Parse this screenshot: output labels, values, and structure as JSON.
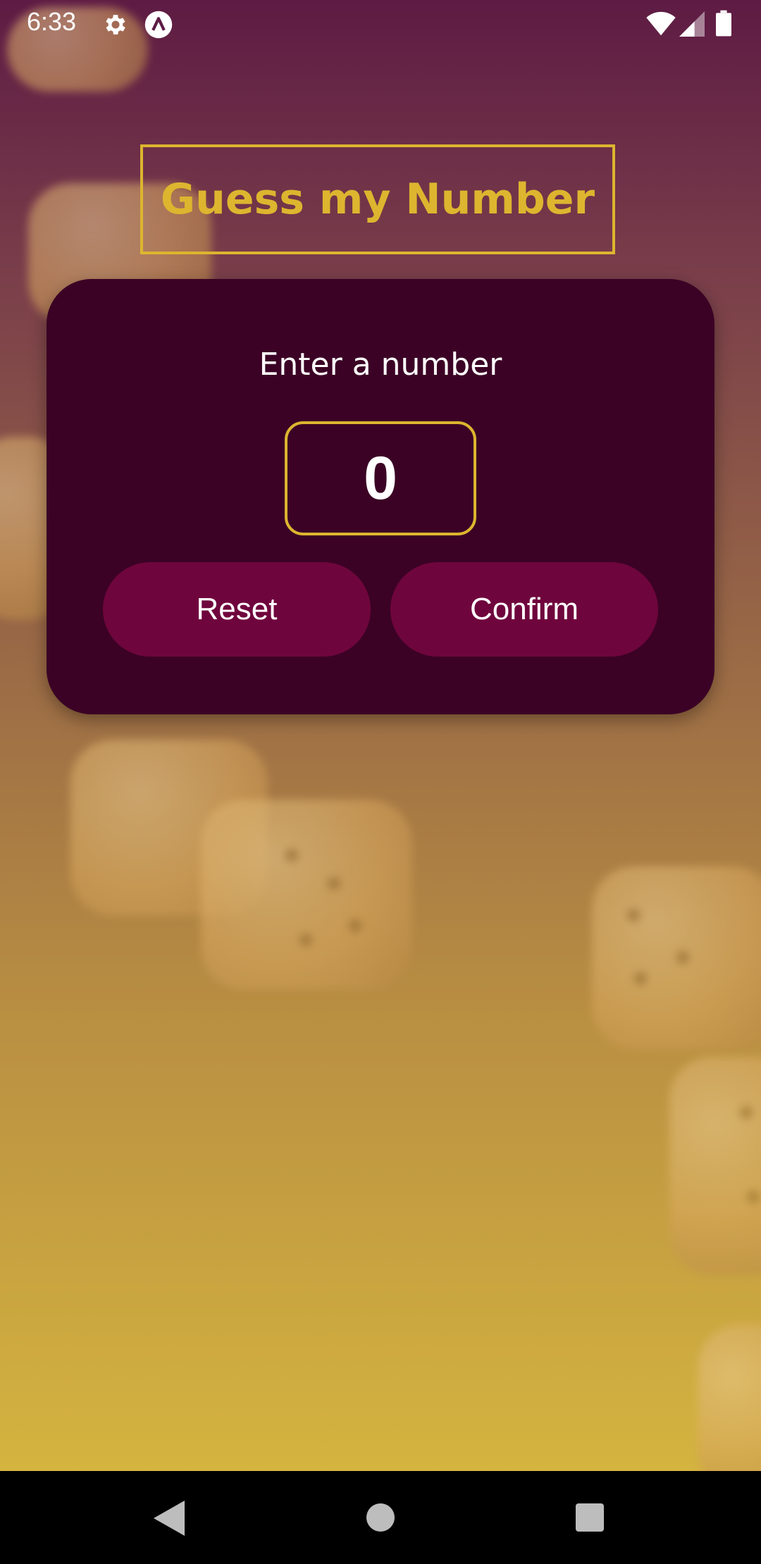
{
  "status_bar": {
    "time": "6:33",
    "icons": [
      "gear-icon",
      "app-notification-icon",
      "wifi-icon",
      "signal-icon",
      "battery-icon"
    ]
  },
  "app": {
    "title": "Guess my Number"
  },
  "card": {
    "prompt": "Enter a number",
    "input_value": "0",
    "reset_label": "Reset",
    "confirm_label": "Confirm"
  },
  "nav_bar": {
    "icons": [
      "back-icon",
      "home-icon",
      "recents-icon"
    ]
  },
  "colors": {
    "accent": "#ddb52f",
    "card_background": "#3b0225",
    "button_background": "#6f053d",
    "gradient_top": "#5e1b44",
    "gradient_bottom": "#d6b53f"
  }
}
